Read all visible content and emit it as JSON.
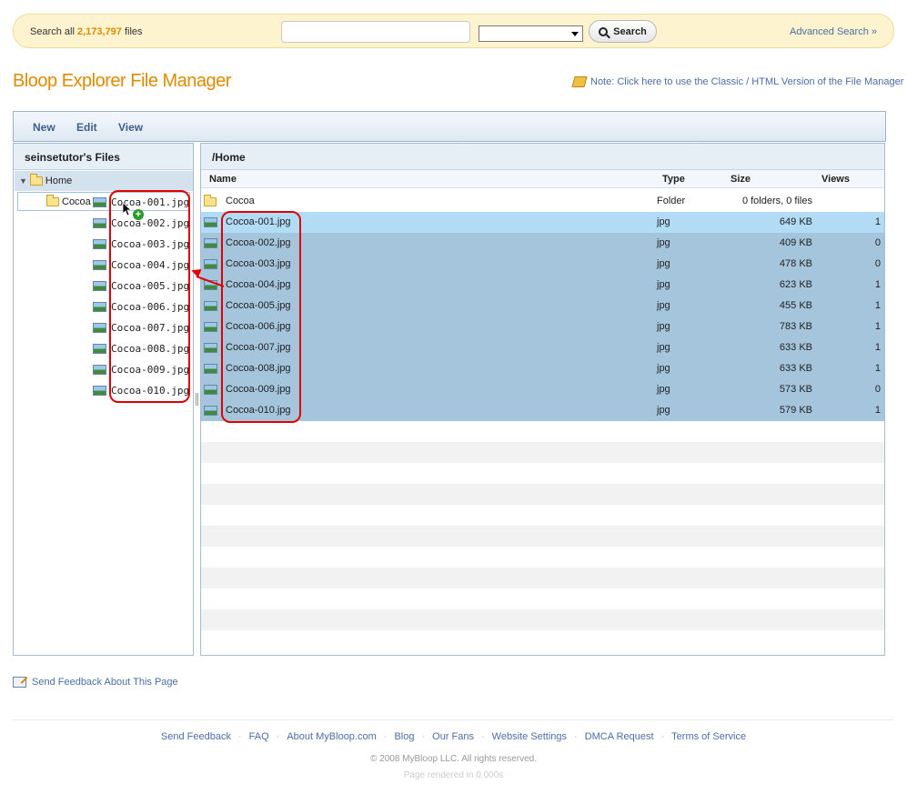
{
  "search": {
    "prefix": "Search all",
    "count": "2,173,797",
    "suffix": "files",
    "input_value": "",
    "select_value": "",
    "button_label": "Search",
    "advanced_link": "Advanced Search »"
  },
  "app_title": "Bloop Explorer File Manager",
  "note": "Note: Click here to use the Classic / HTML Version of the File Manager",
  "toolbar": {
    "new": "New",
    "edit": "Edit",
    "view": "View"
  },
  "tree": {
    "heading": "seinsetutor's Files",
    "root": "Home",
    "folder": "Cocoa",
    "files": [
      "Cocoa-001.jpg",
      "Cocoa-002.jpg",
      "Cocoa-003.jpg",
      "Cocoa-004.jpg",
      "Cocoa-005.jpg",
      "Cocoa-006.jpg",
      "Cocoa-007.jpg",
      "Cocoa-008.jpg",
      "Cocoa-009.jpg",
      "Cocoa-010.jpg"
    ]
  },
  "listing": {
    "path": "/Home",
    "columns": {
      "name": "Name",
      "type": "Type",
      "size": "Size",
      "views": "Views"
    },
    "folder_row": {
      "name": "Cocoa",
      "type": "Folder",
      "size": "0 folders, 0 files",
      "views": ""
    },
    "rows": [
      {
        "name": "Cocoa-001.jpg",
        "type": "jpg",
        "size": "649 KB",
        "views": "1"
      },
      {
        "name": "Cocoa-002.jpg",
        "type": "jpg",
        "size": "409 KB",
        "views": "0"
      },
      {
        "name": "Cocoa-003.jpg",
        "type": "jpg",
        "size": "478 KB",
        "views": "0"
      },
      {
        "name": "Cocoa-004.jpg",
        "type": "jpg",
        "size": "623 KB",
        "views": "1"
      },
      {
        "name": "Cocoa-005.jpg",
        "type": "jpg",
        "size": "455 KB",
        "views": "1"
      },
      {
        "name": "Cocoa-006.jpg",
        "type": "jpg",
        "size": "783 KB",
        "views": "1"
      },
      {
        "name": "Cocoa-007.jpg",
        "type": "jpg",
        "size": "633 KB",
        "views": "1"
      },
      {
        "name": "Cocoa-008.jpg",
        "type": "jpg",
        "size": "633 KB",
        "views": "1"
      },
      {
        "name": "Cocoa-009.jpg",
        "type": "jpg",
        "size": "573 KB",
        "views": "0"
      },
      {
        "name": "Cocoa-010.jpg",
        "type": "jpg",
        "size": "579 KB",
        "views": "1"
      }
    ]
  },
  "feedback_link": "Send Feedback About This Page",
  "footer": {
    "links": [
      "Send Feedback",
      "FAQ",
      "About MyBloop.com",
      "Blog",
      "Our Fans",
      "Website Settings",
      "DMCA Request",
      "Terms of Service"
    ],
    "copyright": "© 2008 MyBloop LLC. All rights reserved.",
    "rendered": "Page rendered in 0.000s"
  },
  "colors": {
    "accent": "#e08a00",
    "link": "#4a6fa5",
    "selection": "#a4c5dc",
    "annotation": "#e00000"
  },
  "icons": [
    "search-icon",
    "folder-icon",
    "image-file-icon",
    "note-icon",
    "feedback-icon",
    "expand-arrow-icon",
    "plus-badge-icon",
    "cursor-icon"
  ]
}
